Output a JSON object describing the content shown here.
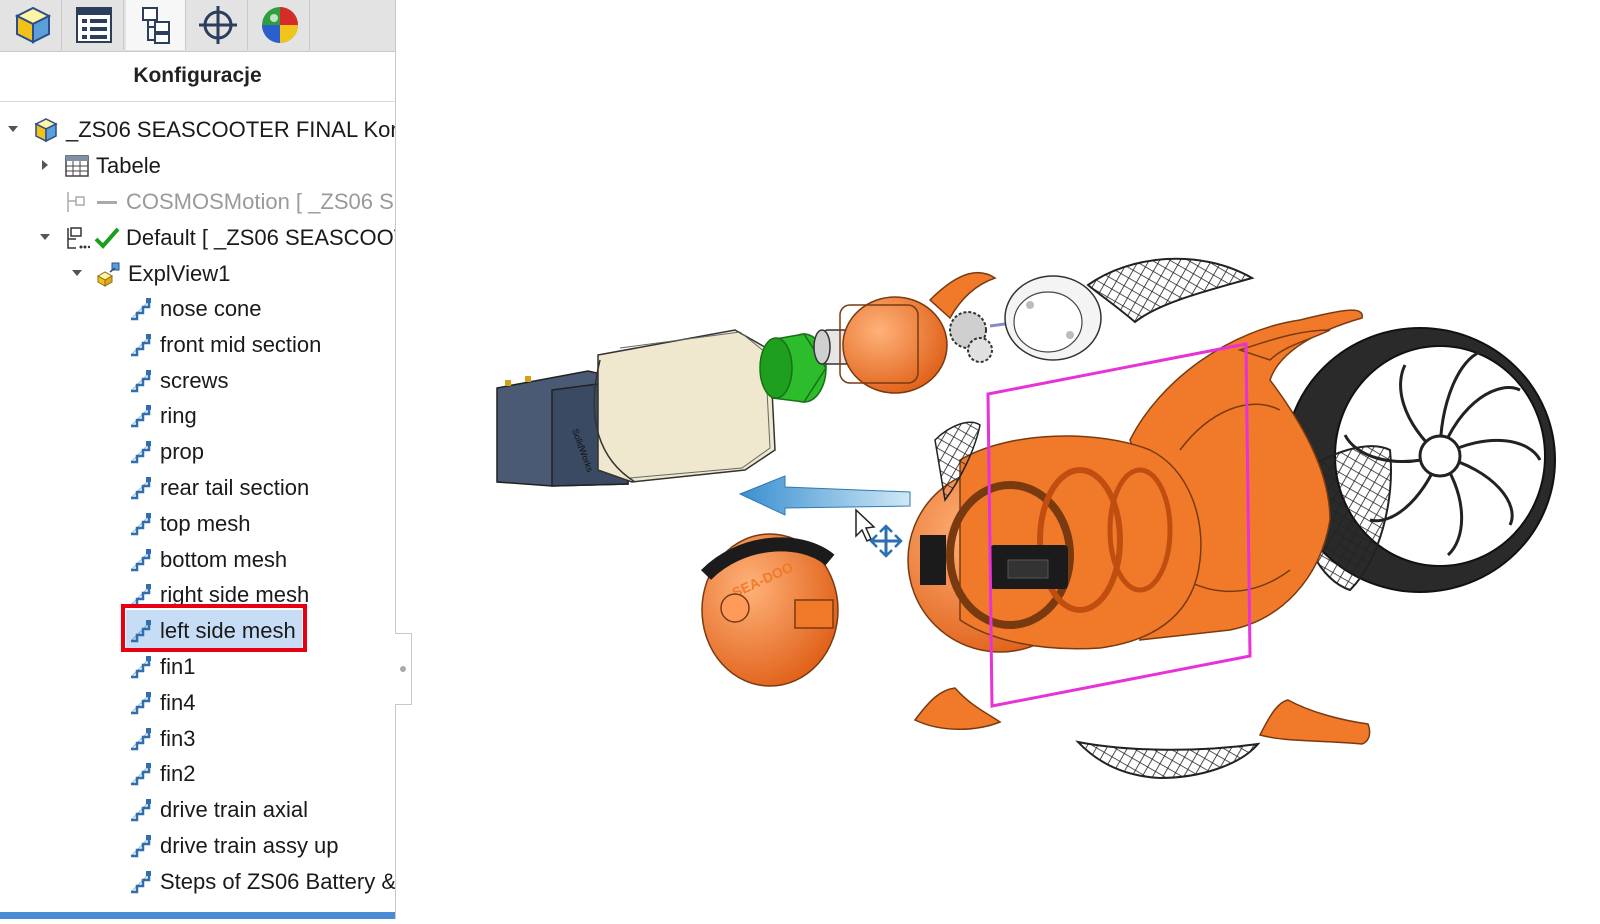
{
  "tabs": [
    {
      "name": "featuremanager-tab",
      "icon": "part-cube-icon"
    },
    {
      "name": "propertymanager-tab",
      "icon": "property-list-icon"
    },
    {
      "name": "configurationmanager-tab",
      "icon": "configuration-tree-icon",
      "active": true
    },
    {
      "name": "dimxpert-tab",
      "icon": "crosshair-icon"
    },
    {
      "name": "display-manager-tab",
      "icon": "appearance-sphere-icon"
    }
  ],
  "panel": {
    "title": "Konfiguracje"
  },
  "tree": {
    "root": "_ZS06 SEASCOOTER FINAL Konfig",
    "tables": "Tabele",
    "cosmos": "COSMOSMotion [ _ZS06 SE",
    "default": "Default [ _ZS06 SEASCOOT",
    "explview": "ExplView1",
    "steps": [
      "nose cone",
      "front mid section",
      "screws",
      "ring",
      "prop",
      "rear tail section",
      "top mesh",
      "bottom mesh",
      "right side mesh",
      "left side mesh",
      "fin1",
      "fin4",
      "fin3",
      "fin2",
      "drive train axial",
      "drive train assy up",
      "Steps of ZS06 Battery &"
    ],
    "selected_step": "left side mesh"
  },
  "viewport": {
    "logo_text": "SEA-DOO",
    "accent": "#f07a2a",
    "selection_color": "#e632d8",
    "arrow_color": "#5aaee0",
    "highlight_color": "#e60012"
  }
}
